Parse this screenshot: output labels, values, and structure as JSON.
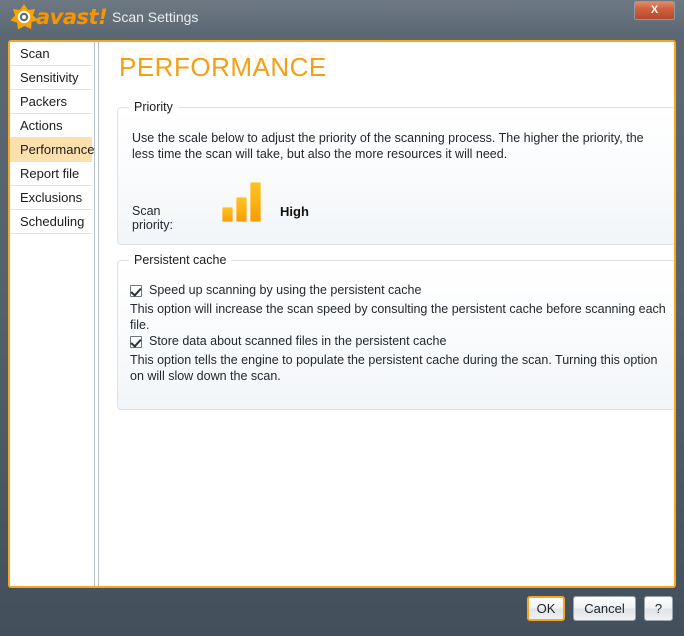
{
  "window": {
    "brand": "avast!",
    "title": "Scan Settings",
    "close_label": "X",
    "accent_color": "#f5a623",
    "titlebar_color": "#63707b"
  },
  "sidebar": {
    "items": [
      {
        "label": "Scan",
        "active": false
      },
      {
        "label": "Sensitivity",
        "active": false
      },
      {
        "label": "Packers",
        "active": false
      },
      {
        "label": "Actions",
        "active": false
      },
      {
        "label": "Performance",
        "active": true
      },
      {
        "label": "Report file",
        "active": false
      },
      {
        "label": "Exclusions",
        "active": false
      },
      {
        "label": "Scheduling",
        "active": false
      }
    ],
    "active_highlight_color": "#fde0ac"
  },
  "main": {
    "page_title": "PERFORMANCE",
    "priority": {
      "legend": "Priority",
      "description": "Use the scale below to adjust the priority of the scanning process. The higher the priority, the less time the scan will take, but also the more resources it will need.",
      "scale_label": "Scan priority:",
      "scale_value": "High",
      "scale_steps": 3,
      "scale_level": 3,
      "bar_color": "#fcb415"
    },
    "persistent_cache": {
      "legend": "Persistent cache",
      "options": [
        {
          "label": "Speed up scanning by using the persistent cache",
          "checked": true,
          "description": "This option will increase the scan speed by consulting the persistent cache before scanning each file."
        },
        {
          "label": "Store data about scanned files in the persistent cache",
          "checked": true,
          "description": "This option tells the engine to populate the persistent cache during the scan. Turning this option on will slow down the scan."
        }
      ]
    }
  },
  "footer": {
    "ok_label": "OK",
    "cancel_label": "Cancel",
    "help_label": "?"
  }
}
